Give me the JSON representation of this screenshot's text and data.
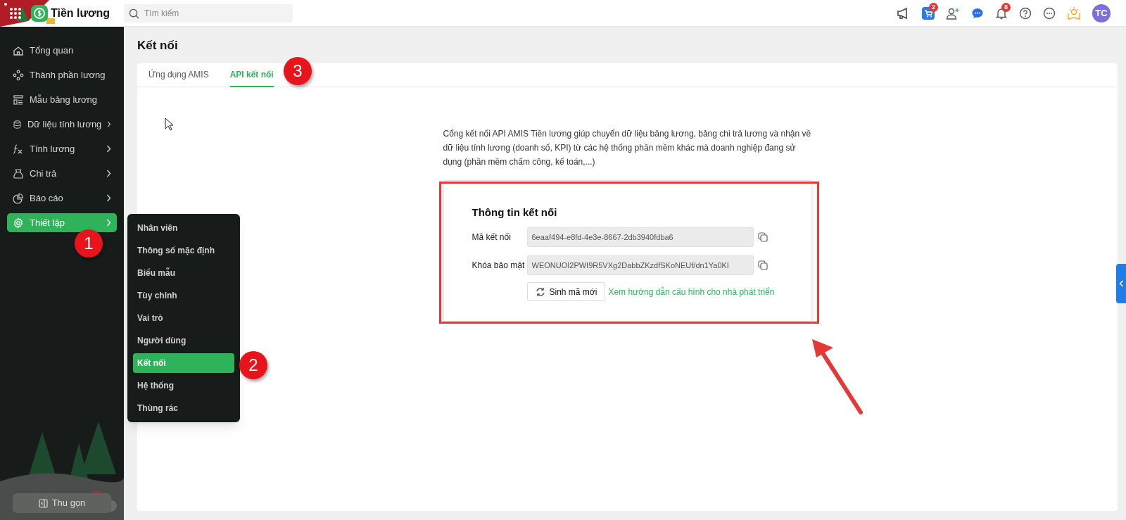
{
  "app": {
    "title": "Tiền lương",
    "search": {
      "placeholder": "Tìm kiếm"
    },
    "header_badges": {
      "cart": "2",
      "notifications": "8"
    },
    "avatar": "TC"
  },
  "sidebar": {
    "items": [
      {
        "label": "Tổng quan",
        "has_submenu": false,
        "selected": false
      },
      {
        "label": "Thành phần lương",
        "has_submenu": false,
        "selected": false
      },
      {
        "label": "Mẫu bảng lương",
        "has_submenu": false,
        "selected": false
      },
      {
        "label": "Dữ liệu tính lương",
        "has_submenu": true,
        "selected": false
      },
      {
        "label": "Tính lương",
        "has_submenu": true,
        "selected": false
      },
      {
        "label": "Chi trả",
        "has_submenu": true,
        "selected": false
      },
      {
        "label": "Báo cáo",
        "has_submenu": true,
        "selected": false
      },
      {
        "label": "Thiết lập",
        "has_submenu": true,
        "selected": true
      }
    ],
    "collapse": "Thu gọn"
  },
  "submenu": {
    "items": [
      {
        "label": "Nhân viên",
        "selected": false
      },
      {
        "label": "Thông số mặc định",
        "selected": false
      },
      {
        "label": "Biểu mẫu",
        "selected": false
      },
      {
        "label": "Tùy chỉnh",
        "selected": false
      },
      {
        "label": "Vai trò",
        "selected": false
      },
      {
        "label": "Người dùng",
        "selected": false
      },
      {
        "label": "Kết nối",
        "selected": true
      },
      {
        "label": "Hệ thống",
        "selected": false
      },
      {
        "label": "Thùng rác",
        "selected": false
      }
    ]
  },
  "page": {
    "title": "Kết nối",
    "tabs": [
      {
        "label": "Ứng dụng AMIS",
        "selected": false
      },
      {
        "label": "API kết nối",
        "selected": true
      }
    ],
    "description": "Cổng kết nối API AMIS Tiền lương giúp chuyển dữ liệu bảng lương, bảng chi trả lương và nhận về dữ liệu tính lương (doanh số, KPI) từ các hệ thống phần mềm khác mà doanh nghiệp đang sử dụng (phần mềm chấm công, kế toán,...)",
    "connection": {
      "title": "Thông tin kết nối",
      "fields": [
        {
          "label": "Mã kết nối",
          "value": "6eaaf494-e8fd-4e3e-8667-2db3940fdba6"
        },
        {
          "label": "Khóa bảo mật",
          "value": "WEONUOI2PWI9R5VXg2DabbZKzdfSKoNEUf/dn1Ya0KI"
        }
      ],
      "regenerate_button": "Sinh mã mới",
      "guide_link": "Xem hướng dẫn cấu hình cho nhà phát triển"
    }
  },
  "annotations": [
    "1",
    "2",
    "3"
  ]
}
